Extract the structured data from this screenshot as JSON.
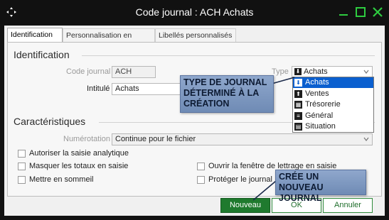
{
  "window": {
    "title": "Code journal : ACH Achats"
  },
  "tabs": [
    "Identification",
    "Personnalisation en saisie",
    "Libellés personnalisés"
  ],
  "identification": {
    "section_title": "Identification",
    "code_label": "Code journal",
    "code_value": "ACH",
    "type_label": "Type",
    "type_value": "Achats",
    "intitule_label": "Intitulé",
    "intitule_value": "Achats"
  },
  "type_options": [
    {
      "label": "Achats",
      "icon": "download-icon",
      "selected": true
    },
    {
      "label": "Ventes",
      "icon": "upload-icon",
      "selected": false
    },
    {
      "label": "Trésorerie",
      "icon": "bank-icon",
      "selected": false
    },
    {
      "label": "Général",
      "icon": "ledger-icon",
      "selected": false
    },
    {
      "label": "Situation",
      "icon": "situation-icon",
      "selected": false
    }
  ],
  "caracteristiques": {
    "section_title": "Caractéristiques",
    "numerotation_label": "Numérotation",
    "numerotation_value": "Continue pour le fichier"
  },
  "checkboxes": {
    "saisie_analytique": "Autoriser la saisie analytique",
    "masquer_totaux": "Masquer les totaux en saisie",
    "mettre_sommeil": "Mettre en sommeil",
    "fenetre_lettrage": "Ouvrir la fenêtre de lettrage en saisie",
    "proteger_journal": "Protéger le journal"
  },
  "callouts": {
    "type_journal": [
      "TYPE DE JOURNAL",
      "DÉTERMINÉ À LA",
      "CRÉATION"
    ],
    "nouveau": [
      "CRÉE UN NOUVEAU",
      "JOURNAL"
    ]
  },
  "buttons": {
    "nouveau": "Nouveau",
    "ok": "OK",
    "annuler": "Annuler"
  },
  "colors": {
    "primary": "#1f7a2e",
    "selection": "#0a5fcf",
    "callout": "#7f98c1"
  }
}
